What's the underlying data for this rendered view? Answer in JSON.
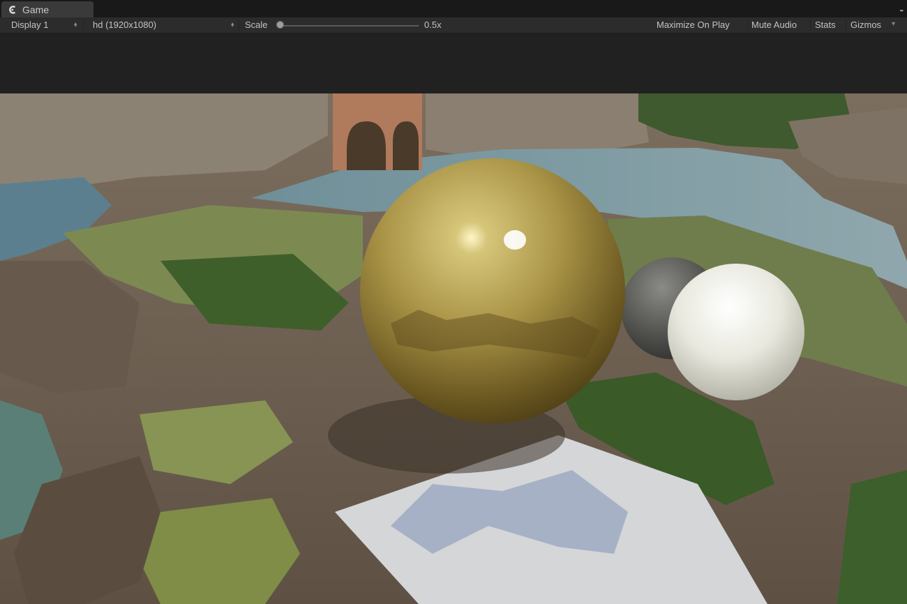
{
  "tab": {
    "title": "Game",
    "icon": "unity-game-icon"
  },
  "toolbar": {
    "display": "Display 1",
    "resolution": "hd (1920x1080)",
    "scale_label": "Scale",
    "scale_value": "0.5x",
    "scale_fraction": 0.02,
    "maximize": "Maximize On Play",
    "mute": "Mute Audio",
    "stats": "Stats",
    "gizmos": "Gizmos"
  },
  "colors": {
    "toolbar_bg": "#2c2c2c",
    "tab_bg": "#3a3a3a",
    "letterbox": "#212121"
  }
}
